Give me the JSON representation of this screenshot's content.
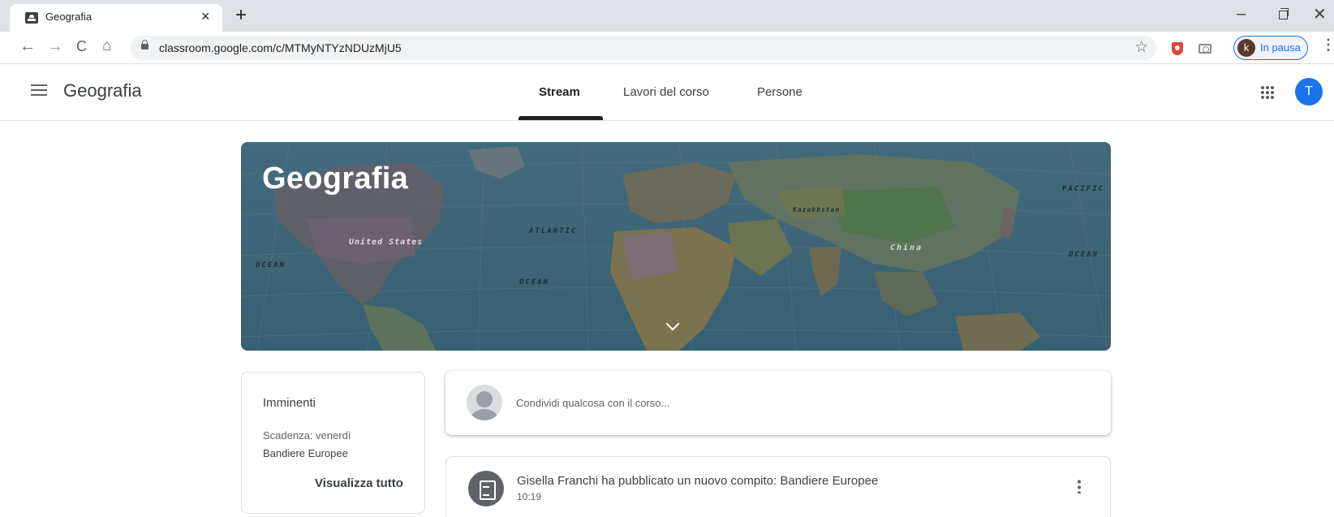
{
  "browser": {
    "tab_title": "Geografia",
    "tab_close": "×",
    "new_tab": "+",
    "url": "classroom.google.com/c/MTMyNTYzNDUzMjU5",
    "profile_initial": "k",
    "profile_label": "In pausa",
    "window_minimize": "–",
    "window_close": "✕",
    "nav_back": "←",
    "nav_forward": "→",
    "nav_reload": "C",
    "nav_home": "⌂",
    "bookmark_star": "☆",
    "menu": "⋮"
  },
  "app": {
    "title": "Geografia",
    "tabs": [
      {
        "label": "Stream",
        "active": true
      },
      {
        "label": "Lavori del corso",
        "active": false
      },
      {
        "label": "Persone",
        "active": false
      }
    ],
    "user_initial": "T",
    "accent": "#1a73e8"
  },
  "banner": {
    "title": "Geografia",
    "map_labels": [
      "ATLANTIC",
      "OCEAN",
      "OCEAN",
      "PACIFIC",
      "OCEAN",
      "United States",
      "China",
      "Kazakhstan"
    ]
  },
  "upcoming": {
    "title": "Imminenti",
    "due": "Scadenza: venerdì",
    "item": "Bandiere Europee",
    "view_all": "Visualizza tutto"
  },
  "share": {
    "placeholder": "Condividi qualcosa con il corso..."
  },
  "stream": {
    "posts": [
      {
        "title": "Gisella Franchi ha pubblicato un nuovo compito: Bandiere Europee",
        "time": "10:19"
      }
    ]
  },
  "icons": [
    "assignment-icon",
    "apps-grid-icon",
    "hamburger-icon",
    "chevron-down-icon",
    "more-vert-icon",
    "lock-icon",
    "star-icon",
    "shield-extension-icon",
    "camera-extension-icon"
  ]
}
